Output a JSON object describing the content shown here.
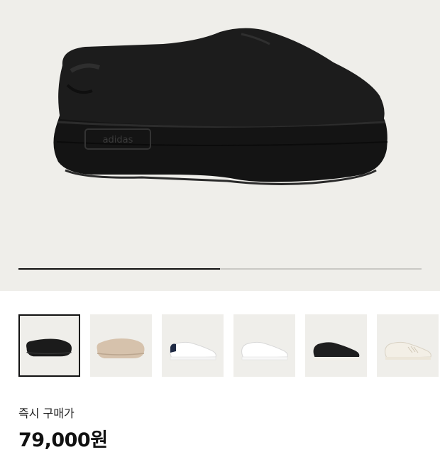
{
  "hero": {
    "product_image": "black-platform-mule",
    "logo_text": "adidas",
    "carousel_progress": 0.5
  },
  "thumbnails": [
    {
      "name": "black-mule",
      "selected": true,
      "color": "#1b1b1b"
    },
    {
      "name": "beige-mule",
      "selected": false,
      "color": "#d6c2ac"
    },
    {
      "name": "white-sneaker-navy-heel",
      "selected": false,
      "color": "#ffffff"
    },
    {
      "name": "white-sneaker",
      "selected": false,
      "color": "#ffffff"
    },
    {
      "name": "black-sneaker",
      "selected": false,
      "color": "#1e1e1e"
    },
    {
      "name": "cream-sneaker",
      "selected": false,
      "color": "#f3efe6"
    }
  ],
  "price": {
    "label": "즉시 구매가",
    "value": "79,000원"
  },
  "colors": {
    "background": "#efeeea",
    "accent": "#111111"
  }
}
